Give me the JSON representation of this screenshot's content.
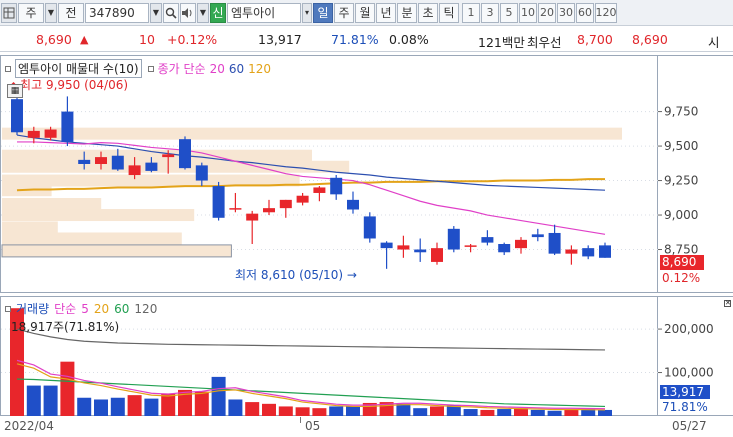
{
  "toolbar": {
    "market_select": "주",
    "prev_button": "전",
    "stock_code": "347890",
    "signal_button": "신",
    "stock_name": "엠투아이",
    "periods": [
      "일",
      "주",
      "월",
      "년",
      "분",
      "초",
      "틱"
    ],
    "active_period": "일",
    "minute_options": [
      "1",
      "3",
      "5",
      "10",
      "20",
      "30",
      "60",
      "120"
    ]
  },
  "info": {
    "price": "8,690",
    "change_arrow": "▲",
    "change": "10",
    "change_pct": "+0.12%",
    "volume": "13,917",
    "volume_ratio": "71.81%",
    "turnover": "0.08%",
    "amount": "121백만",
    "ask_label": "최우선",
    "ask": "8,700",
    "bid": "8,690",
    "last_label": "시"
  },
  "price_chart": {
    "title": "엠투아이 매물대 수(10)",
    "legend_close": "종가 단순",
    "ma_labels": [
      "20",
      "60",
      "120"
    ],
    "high_label": "최고 9,950 (04/06)",
    "low_label": "최저 8,610 (05/10)",
    "axis_ticks": [
      "9,750",
      "9,500",
      "9,250",
      "9,000",
      "8,750"
    ],
    "current_price": "8,690",
    "current_pct": "0.12%"
  },
  "volume_chart": {
    "title": "거래량",
    "legend_simple": "단순",
    "ma_labels": [
      "5",
      "20",
      "60",
      "120"
    ],
    "peak_label": "18,917주(71.81%)",
    "axis_ticks": [
      "200,000",
      "100,000"
    ],
    "current_volume": "13,917",
    "current_pct": "71.81%"
  },
  "dates": {
    "start": "2022/04",
    "mid": "05",
    "end": "05/27"
  },
  "colors": {
    "up": "#e8262b",
    "down": "#1f4fc8",
    "ma20": "#e040c8",
    "ma60": "#2c4fb0",
    "ma120": "#e3a319",
    "profile": "#f7e6d3"
  },
  "chart_data": {
    "type": "candlestick",
    "price_range": [
      8500,
      9950
    ],
    "candles": [
      {
        "o": 9840,
        "h": 9950,
        "l": 9580,
        "c": 9600
      },
      {
        "o": 9560,
        "h": 9640,
        "l": 9520,
        "c": 9610
      },
      {
        "o": 9560,
        "h": 9640,
        "l": 9540,
        "c": 9620
      },
      {
        "o": 9750,
        "h": 9860,
        "l": 9500,
        "c": 9530
      },
      {
        "o": 9400,
        "h": 9460,
        "l": 9330,
        "c": 9370
      },
      {
        "o": 9370,
        "h": 9460,
        "l": 9330,
        "c": 9420
      },
      {
        "o": 9430,
        "h": 9480,
        "l": 9320,
        "c": 9330
      },
      {
        "o": 9290,
        "h": 9420,
        "l": 9260,
        "c": 9360
      },
      {
        "o": 9380,
        "h": 9420,
        "l": 9310,
        "c": 9320
      },
      {
        "o": 9420,
        "h": 9470,
        "l": 9300,
        "c": 9440
      },
      {
        "o": 9550,
        "h": 9570,
        "l": 9330,
        "c": 9340
      },
      {
        "o": 9360,
        "h": 9380,
        "l": 9210,
        "c": 9250
      },
      {
        "o": 9210,
        "h": 9240,
        "l": 8960,
        "c": 8980
      },
      {
        "o": 9040,
        "h": 9160,
        "l": 9020,
        "c": 9050
      },
      {
        "o": 8960,
        "h": 9030,
        "l": 8790,
        "c": 9010
      },
      {
        "o": 9020,
        "h": 9110,
        "l": 9000,
        "c": 9050
      },
      {
        "o": 9050,
        "h": 9110,
        "l": 8980,
        "c": 9110
      },
      {
        "o": 9090,
        "h": 9160,
        "l": 9070,
        "c": 9140
      },
      {
        "o": 9160,
        "h": 9210,
        "l": 9100,
        "c": 9200
      },
      {
        "o": 9270,
        "h": 9290,
        "l": 9110,
        "c": 9150
      },
      {
        "o": 9110,
        "h": 9170,
        "l": 9010,
        "c": 9040
      },
      {
        "o": 8990,
        "h": 9020,
        "l": 8800,
        "c": 8830
      },
      {
        "o": 8800,
        "h": 8810,
        "l": 8610,
        "c": 8760
      },
      {
        "o": 8750,
        "h": 8850,
        "l": 8690,
        "c": 8780
      },
      {
        "o": 8750,
        "h": 8830,
        "l": 8660,
        "c": 8730
      },
      {
        "o": 8660,
        "h": 8800,
        "l": 8640,
        "c": 8760
      },
      {
        "o": 8900,
        "h": 8920,
        "l": 8730,
        "c": 8750
      },
      {
        "o": 8770,
        "h": 8790,
        "l": 8730,
        "c": 8780
      },
      {
        "o": 8840,
        "h": 8890,
        "l": 8780,
        "c": 8800
      },
      {
        "o": 8790,
        "h": 8800,
        "l": 8710,
        "c": 8730
      },
      {
        "o": 8760,
        "h": 8840,
        "l": 8720,
        "c": 8820
      },
      {
        "o": 8860,
        "h": 8900,
        "l": 8810,
        "c": 8840
      },
      {
        "o": 8870,
        "h": 8930,
        "l": 8710,
        "c": 8720
      },
      {
        "o": 8720,
        "h": 8780,
        "l": 8640,
        "c": 8750
      },
      {
        "o": 8760,
        "h": 8780,
        "l": 8680,
        "c": 8700
      },
      {
        "o": 8780,
        "h": 8800,
        "l": 8690,
        "c": 8690
      }
    ],
    "ma20": [
      9530,
      9530,
      9525,
      9520,
      9515,
      9525,
      9520,
      9505,
      9490,
      9480,
      9470,
      9450,
      9420,
      9390,
      9360,
      9330,
      9300,
      9280,
      9270,
      9260,
      9250,
      9220,
      9180,
      9140,
      9100,
      9070,
      9050,
      9030,
      9000,
      8980,
      8960,
      8940,
      8920,
      8900,
      8880,
      8860
    ],
    "ma60": [
      9580,
      9560,
      9545,
      9530,
      9520,
      9510,
      9500,
      9480,
      9460,
      9445,
      9430,
      9420,
      9405,
      9390,
      9380,
      9365,
      9350,
      9340,
      9325,
      9310,
      9300,
      9290,
      9275,
      9265,
      9255,
      9245,
      9235,
      9225,
      9215,
      9210,
      9205,
      9200,
      9195,
      9190,
      9185,
      9180
    ],
    "ma120": [
      9180,
      9185,
      9185,
      9190,
      9190,
      9195,
      9200,
      9200,
      9200,
      9205,
      9210,
      9210,
      9210,
      9215,
      9215,
      9215,
      9220,
      9220,
      9225,
      9230,
      9235,
      9235,
      9240,
      9240,
      9240,
      9245,
      9245,
      9245,
      9245,
      9250,
      9250,
      9250,
      9255,
      9255,
      9260,
      9260
    ],
    "volume_profile": [
      {
        "price": 9590,
        "rel": 1.0
      },
      {
        "price": 9430,
        "rel": 0.5
      },
      {
        "price": 9350,
        "rel": 0.56
      },
      {
        "price": 9250,
        "rel": 0.48
      },
      {
        "price": 9180,
        "rel": 0.08
      },
      {
        "price": 9080,
        "rel": 0.16
      },
      {
        "price": 9000,
        "rel": 0.31
      },
      {
        "price": 8910,
        "rel": 0.09
      },
      {
        "price": 8830,
        "rel": 0.29
      },
      {
        "price": 8740,
        "rel": 0.37
      }
    ],
    "volume_range": [
      0,
      260000
    ],
    "volume": [
      248000,
      70000,
      70000,
      125000,
      42000,
      38000,
      42000,
      48000,
      40000,
      52000,
      60000,
      56000,
      90000,
      38000,
      32000,
      28000,
      22000,
      20000,
      18000,
      22000,
      22000,
      30000,
      32000,
      28000,
      18000,
      22000,
      25000,
      16000,
      14000,
      16000,
      18000,
      14000,
      12000,
      14000,
      16000,
      13917
    ],
    "volume_up": [
      true,
      false,
      false,
      true,
      false,
      false,
      false,
      true,
      false,
      true,
      true,
      true,
      false,
      false,
      true,
      true,
      true,
      true,
      true,
      false,
      false,
      true,
      true,
      false,
      false,
      true,
      false,
      false,
      true,
      false,
      true,
      false,
      false,
      true,
      false,
      false
    ],
    "vol_ma5": [
      120000,
      110000,
      90000,
      85000,
      76000,
      70000,
      62000,
      55000,
      48000,
      46000,
      50000,
      52000,
      58000,
      60000,
      52000,
      46000,
      40000,
      32000,
      28000,
      24000,
      22000,
      22000,
      24000,
      26000,
      26000,
      24000,
      22000,
      21000,
      19000,
      18000,
      17000,
      16000,
      15000,
      15000,
      14500,
      14000
    ],
    "vol_ma20": [
      85000,
      84000,
      82000,
      80000,
      78000,
      76000,
      74000,
      72000,
      70000,
      68000,
      66000,
      64000,
      62000,
      60000,
      58000,
      56000,
      54000,
      52000,
      50000,
      48000,
      46000,
      44000,
      42000,
      40000,
      38000,
      36000,
      34000,
      32000,
      30000,
      28000,
      27000,
      26000,
      25000,
      24000,
      23000,
      22000
    ],
    "vol_ma60": [
      200000,
      190000,
      182000,
      176000,
      172000,
      170000,
      168000,
      167000,
      166000,
      165000,
      164500,
      164000,
      163500,
      163000,
      162500,
      162000,
      161500,
      161000,
      160500,
      160000,
      159500,
      159000,
      158500,
      158000,
      157500,
      157000,
      156500,
      156000,
      155500,
      155000,
      154500,
      154000,
      153500,
      153000,
      152500,
      152000
    ]
  }
}
